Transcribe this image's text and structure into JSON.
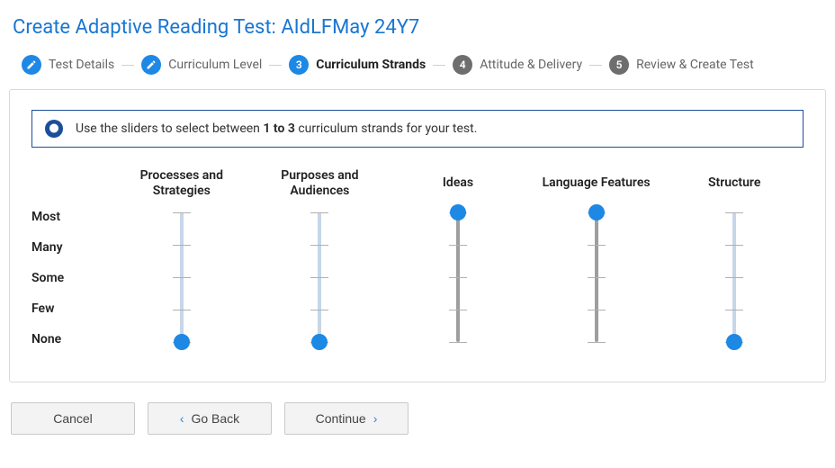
{
  "title": "Create Adaptive Reading Test: AIdLFMay 24Y7",
  "stepper": {
    "steps": [
      {
        "label": "Test Details",
        "icon": "pencil",
        "state": "done"
      },
      {
        "label": "Curriculum Level",
        "icon": "pencil",
        "state": "done"
      },
      {
        "label": "Curriculum Strands",
        "icon": "3",
        "state": "active"
      },
      {
        "label": "Attitude & Delivery",
        "icon": "4",
        "state": "upcoming"
      },
      {
        "label": "Review & Create Test",
        "icon": "5",
        "state": "upcoming"
      }
    ]
  },
  "info": {
    "prefix": "Use the sliders to select between ",
    "bold": "1 to 3",
    "suffix": " curriculum strands for your test."
  },
  "scale_labels": [
    "Most",
    "Many",
    "Some",
    "Few",
    "None"
  ],
  "strands": [
    {
      "name": "Processes and Strategies",
      "value": "None"
    },
    {
      "name": "Purposes and Audiences",
      "value": "None"
    },
    {
      "name": "Ideas",
      "value": "Most"
    },
    {
      "name": "Language Features",
      "value": "Most"
    },
    {
      "name": "Structure",
      "value": "None"
    }
  ],
  "actions": {
    "cancel": "Cancel",
    "back": "Go Back",
    "continue": "Continue"
  },
  "colors": {
    "accent": "#1e88e5",
    "accent_dark": "#1b4f99",
    "gray_step": "#6e6e6e"
  }
}
